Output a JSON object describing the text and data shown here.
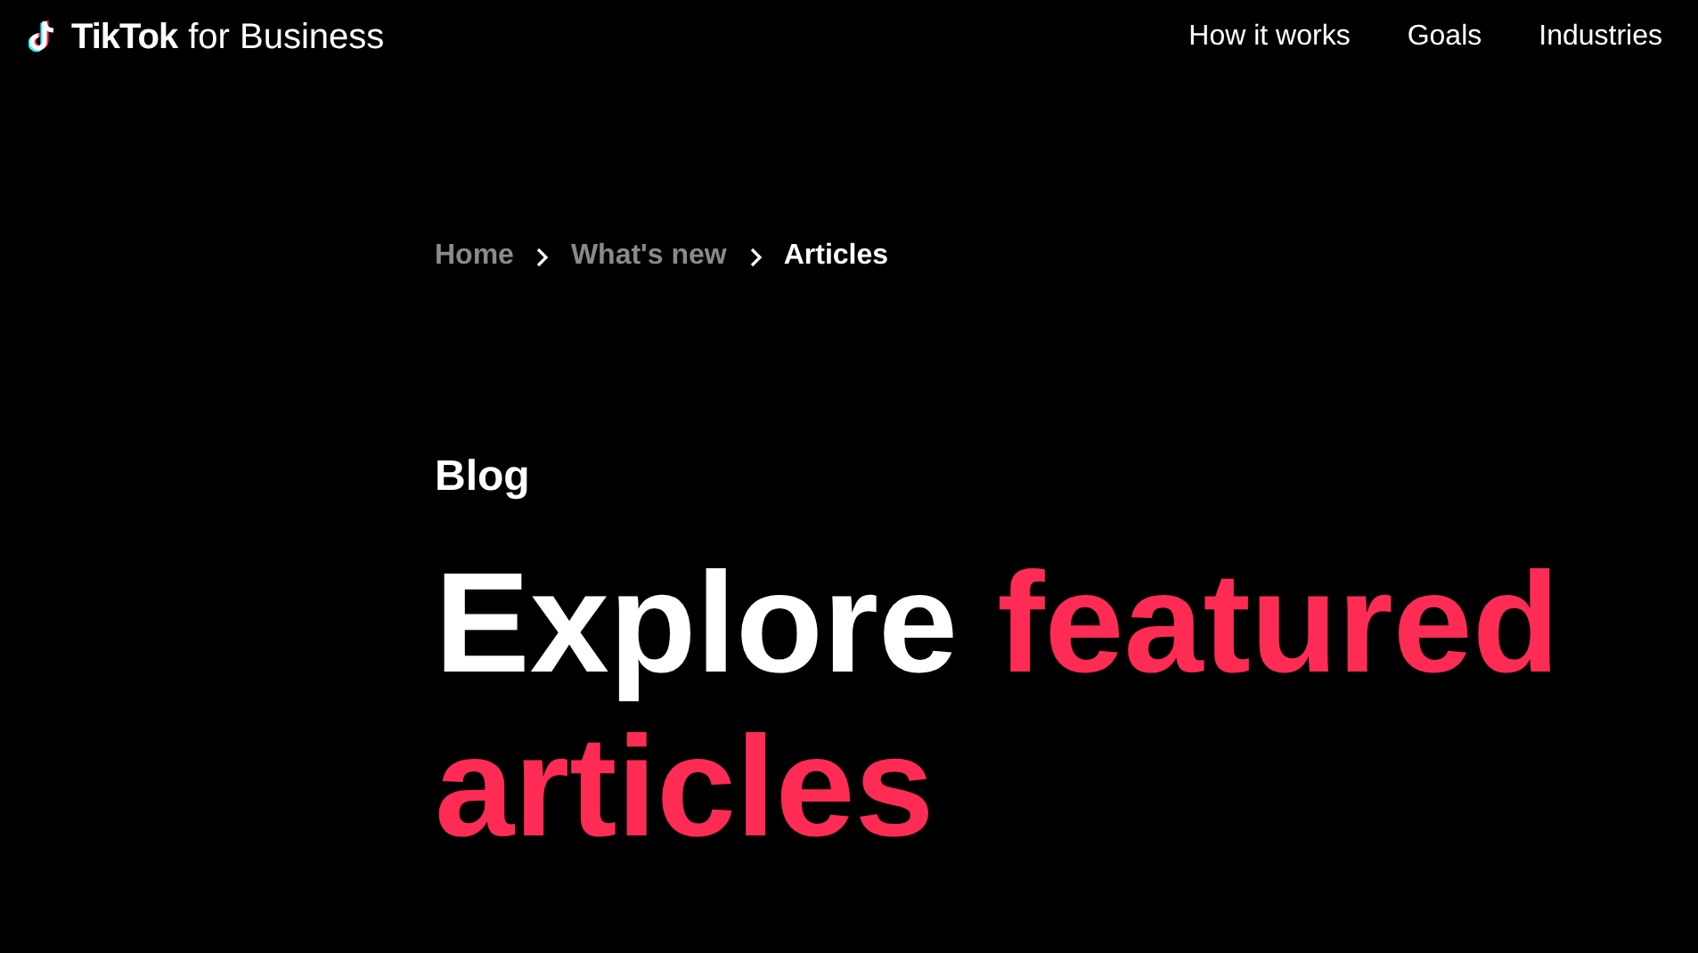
{
  "header": {
    "logo": {
      "brand": "TikTok",
      "suffix": "for Business"
    },
    "nav": [
      {
        "label": "How it works"
      },
      {
        "label": "Goals"
      },
      {
        "label": "Industries"
      }
    ]
  },
  "breadcrumb": [
    {
      "label": "Home",
      "selected": false
    },
    {
      "label": "What's new",
      "selected": false
    },
    {
      "label": "Articles",
      "selected": true
    }
  ],
  "eyebrow": "Blog",
  "headline": [
    {
      "text": "Explore",
      "accent": false
    },
    {
      "text": "featured articles",
      "accent": true
    }
  ]
}
